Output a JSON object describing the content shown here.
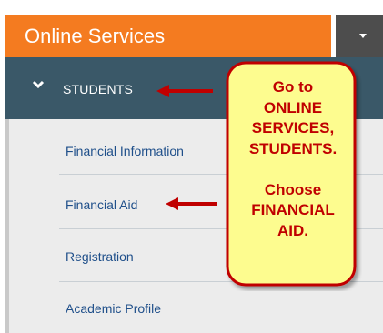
{
  "header": {
    "title": "Online Services"
  },
  "section": {
    "label": "STUDENTS"
  },
  "menu": {
    "items": [
      {
        "label": "Financial Information"
      },
      {
        "label": "Financial Aid"
      },
      {
        "label": "Registration"
      },
      {
        "label": "Academic Profile"
      }
    ]
  },
  "callout": {
    "lines": [
      "Go to",
      "ONLINE",
      "SERVICES,",
      "STUDENTS.",
      "",
      "Choose",
      "FINANCIAL",
      "AID."
    ]
  },
  "colors": {
    "header_bg": "#f47b20",
    "section_bg": "#3a5868",
    "menu_bg": "#ececec",
    "link": "#1f4f8a",
    "callout_bg": "#fdfc8f",
    "callout_border": "#c00000",
    "arrow": "#c00000"
  },
  "icons": [
    "chevron-down-icon",
    "caret-down-icon",
    "red-arrow-icon"
  ]
}
